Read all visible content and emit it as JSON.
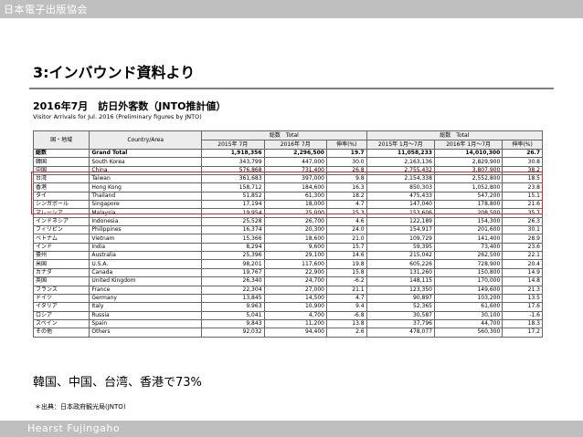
{
  "header": {
    "org": "日本電子出版協会"
  },
  "slide": {
    "title": "3:インバウンド資料より"
  },
  "table_title": "2016年7月　訪日外客数（JNTO推計値）",
  "table_subtitle": "Visitor Arrivals for Jul. 2016 (Preliminary figures by JNTO)",
  "table_headers": {
    "country_ja": "国・地域",
    "country_en": "Country/Area",
    "total_july": "総数　Total",
    "total_ytd": "総数　Total",
    "y2015_m": "2015年 7月",
    "y2016_m": "2016年 7月",
    "growth": "伸率(%)",
    "y2015_ytd": "2015年 1月～7月",
    "y2016_ytd": "2016年 1月～7月",
    "growth2": "伸率(%)"
  },
  "table_rows": [
    {
      "ja": "総数",
      "en": "Grand Total",
      "v1": "1,918,356",
      "v2": "2,296,500",
      "g1": "19.7",
      "v3": "11,058,233",
      "v4": "14,010,300",
      "g2": "26.7"
    },
    {
      "ja": "韓国",
      "en": "South Korea",
      "v1": "343,799",
      "v2": "447,000",
      "g1": "30.0",
      "v3": "2,163,136",
      "v4": "2,829,900",
      "g2": "30.8"
    },
    {
      "ja": "中国",
      "en": "China",
      "v1": "576,868",
      "v2": "731,400",
      "g1": "26.8",
      "v3": "2,755,432",
      "v4": "3,807,900",
      "g2": "38.2"
    },
    {
      "ja": "台湾",
      "en": "Taiwan",
      "v1": "361,683",
      "v2": "397,000",
      "g1": "9.8",
      "v3": "2,154,338",
      "v4": "2,552,800",
      "g2": "18.5"
    },
    {
      "ja": "香港",
      "en": "Hong Kong",
      "v1": "158,712",
      "v2": "184,600",
      "g1": "16.3",
      "v3": "850,303",
      "v4": "1,052,800",
      "g2": "23.8"
    },
    {
      "ja": "タイ",
      "en": "Thailand",
      "v1": "51,852",
      "v2": "61,300",
      "g1": "18.2",
      "v3": "475,433",
      "v4": "547,200",
      "g2": "15.1"
    },
    {
      "ja": "シンガポール",
      "en": "Singapore",
      "v1": "17,194",
      "v2": "18,000",
      "g1": "4.7",
      "v3": "147,040",
      "v4": "178,800",
      "g2": "21.6"
    },
    {
      "ja": "マレーシア",
      "en": "Malaysia",
      "v1": "19,954",
      "v2": "25,000",
      "g1": "25.3",
      "v3": "153,606",
      "v4": "208,500",
      "g2": "35.7"
    },
    {
      "ja": "インドネシア",
      "en": "Indonesia",
      "v1": "25,528",
      "v2": "26,700",
      "g1": "4.6",
      "v3": "122,189",
      "v4": "154,300",
      "g2": "26.3"
    },
    {
      "ja": "フィリピン",
      "en": "Philippines",
      "v1": "16,374",
      "v2": "20,300",
      "g1": "24.0",
      "v3": "154,917",
      "v4": "201,600",
      "g2": "30.1"
    },
    {
      "ja": "ベトナム",
      "en": "Vietnam",
      "v1": "15,366",
      "v2": "18,600",
      "g1": "21.0",
      "v3": "109,729",
      "v4": "141,400",
      "g2": "28.9"
    },
    {
      "ja": "インド",
      "en": "India",
      "v1": "8,294",
      "v2": "9,600",
      "g1": "15.7",
      "v3": "59,395",
      "v4": "73,400",
      "g2": "23.6"
    },
    {
      "ja": "豪州",
      "en": "Australia",
      "v1": "25,396",
      "v2": "29,100",
      "g1": "14.6",
      "v3": "215,042",
      "v4": "262,500",
      "g2": "22.1"
    },
    {
      "ja": "米国",
      "en": "U.S.A.",
      "v1": "98,201",
      "v2": "117,600",
      "g1": "19.8",
      "v3": "605,226",
      "v4": "728,900",
      "g2": "20.4"
    },
    {
      "ja": "カナダ",
      "en": "Canada",
      "v1": "19,767",
      "v2": "22,900",
      "g1": "15.8",
      "v3": "131,260",
      "v4": "150,800",
      "g2": "14.9"
    },
    {
      "ja": "英国",
      "en": "United Kingdom",
      "v1": "26,340",
      "v2": "24,700",
      "g1": "-6.2",
      "v3": "148,115",
      "v4": "170,000",
      "g2": "14.8"
    },
    {
      "ja": "フランス",
      "en": "France",
      "v1": "22,304",
      "v2": "27,000",
      "g1": "21.1",
      "v3": "123,350",
      "v4": "149,600",
      "g2": "21.3"
    },
    {
      "ja": "ドイツ",
      "en": "Germany",
      "v1": "13,845",
      "v2": "14,500",
      "g1": "4.7",
      "v3": "90,897",
      "v4": "103,200",
      "g2": "13.5"
    },
    {
      "ja": "イタリア",
      "en": "Italy",
      "v1": "9,963",
      "v2": "10,900",
      "g1": "9.4",
      "v3": "52,365",
      "v4": "61,600",
      "g2": "17.6"
    },
    {
      "ja": "ロシア",
      "en": "Russia",
      "v1": "5,041",
      "v2": "4,700",
      "g1": "-6.8",
      "v3": "30,587",
      "v4": "30,100",
      "g2": "-1.6"
    },
    {
      "ja": "スペイン",
      "en": "Spain",
      "v1": "9,843",
      "v2": "11,200",
      "g1": "13.8",
      "v3": "37,796",
      "v4": "44,700",
      "g2": "18.3"
    },
    {
      "ja": "その他",
      "en": "Others",
      "v1": "92,032",
      "v2": "94,400",
      "g1": "2.6",
      "v3": "478,077",
      "v4": "560,300",
      "g2": "17.2"
    }
  ],
  "highlight_color": "#d9272e",
  "footnote": "韓国、中国、台湾、香港で73%",
  "source": "＊出典：日本政府観光局(JNTO)",
  "footer": {
    "brand": "Hearst Fujingaho"
  }
}
